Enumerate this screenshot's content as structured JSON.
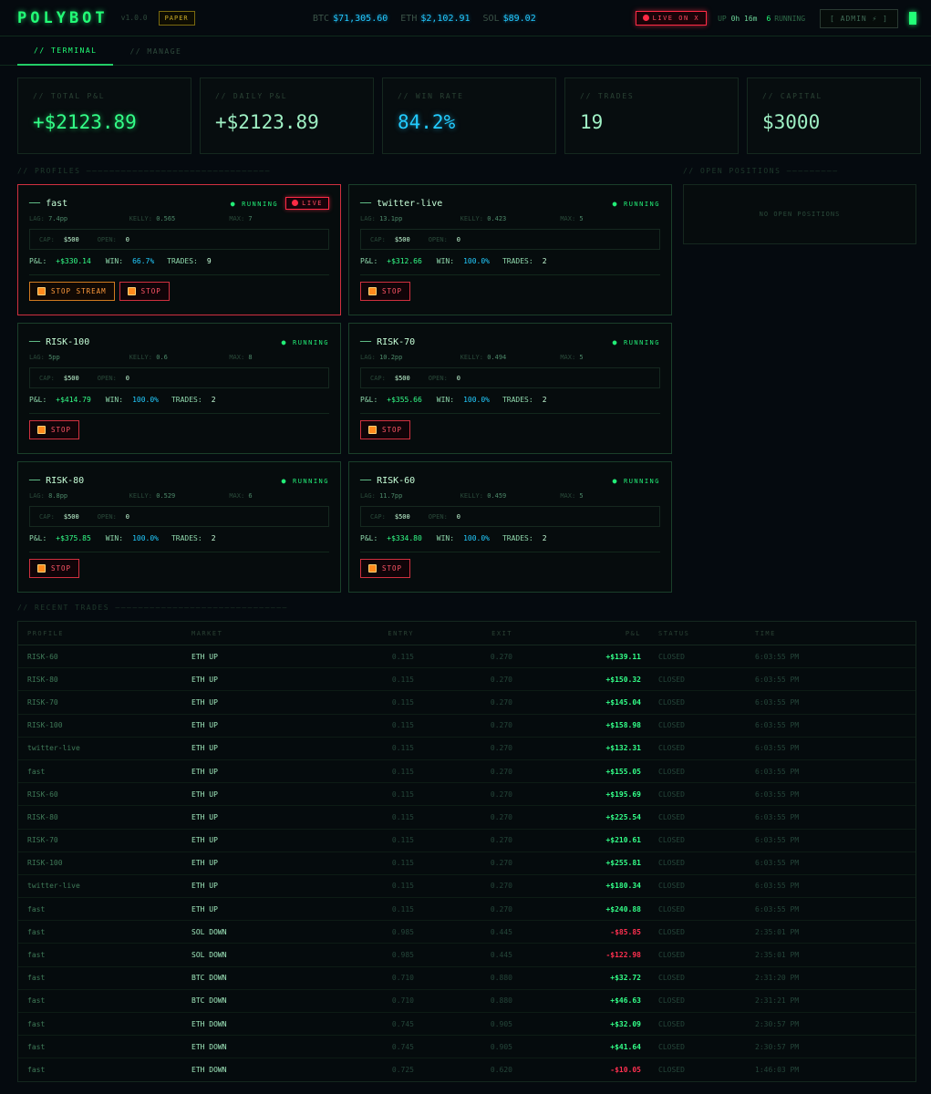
{
  "header": {
    "logo": "POLYBOT",
    "version": "v1.0.0",
    "mode_badge": "PAPER",
    "tickers": [
      {
        "symbol": "BTC",
        "price": "$71,305.60"
      },
      {
        "symbol": "ETH",
        "price": "$2,102.91"
      },
      {
        "symbol": "SOL",
        "price": "$89.02"
      }
    ],
    "live_on_x": "LIVE ON X",
    "uptime_label": "UP",
    "uptime_value": "0h 16m",
    "running_count": "6",
    "running_label": "RUNNING",
    "admin_label": "[ ADMIN ⚡ ]"
  },
  "tabs": [
    {
      "label": "// TERMINAL",
      "active": true
    },
    {
      "label": "// MANAGE",
      "active": false
    }
  ],
  "stats": [
    {
      "label": "// TOTAL P&L",
      "value": "+$2123.89",
      "style": "green"
    },
    {
      "label": "// DAILY P&L",
      "value": "+$2123.89",
      "style": "plain"
    },
    {
      "label": "// WIN RATE",
      "value": "84.2%",
      "style": "cyan"
    },
    {
      "label": "// TRADES",
      "value": "19",
      "style": "plain"
    },
    {
      "label": "// CAPITAL",
      "value": "$3000",
      "style": "plain"
    }
  ],
  "sections": {
    "profiles": "// PROFILES ————————————————————————————————",
    "open_positions": "// OPEN POSITIONS —————————",
    "recent_trades": "// RECENT TRADES ——————————————————————————————"
  },
  "open_positions_empty": "NO OPEN POSITIONS",
  "profile_labels": {
    "lag": "LAG:",
    "kelly": "KELLY:",
    "max": "MAX:",
    "cap": "CAP:",
    "open": "OPEN:",
    "pnl": "P&L:",
    "win": "WIN:",
    "trades": "TRADES:",
    "running": "RUNNING",
    "live": "LIVE",
    "stop": "STOP",
    "stop_stream": "STOP STREAM"
  },
  "profiles": [
    {
      "name": "fast",
      "live": true,
      "lag": "7.4pp",
      "kelly": "0.565",
      "max": "7",
      "cap": "$500",
      "open": "0",
      "pnl": "+$330.14",
      "win": "66.7%",
      "trades": "9"
    },
    {
      "name": "twitter-live",
      "live": false,
      "lag": "13.1pp",
      "kelly": "0.423",
      "max": "5",
      "cap": "$500",
      "open": "0",
      "pnl": "+$312.66",
      "win": "100.0%",
      "trades": "2"
    },
    {
      "name": "RISK-100",
      "live": false,
      "lag": "5pp",
      "kelly": "0.6",
      "max": "8",
      "cap": "$500",
      "open": "0",
      "pnl": "+$414.79",
      "win": "100.0%",
      "trades": "2"
    },
    {
      "name": "RISK-70",
      "live": false,
      "lag": "10.2pp",
      "kelly": "0.494",
      "max": "5",
      "cap": "$500",
      "open": "0",
      "pnl": "+$355.66",
      "win": "100.0%",
      "trades": "2"
    },
    {
      "name": "RISK-80",
      "live": false,
      "lag": "8.8pp",
      "kelly": "0.529",
      "max": "6",
      "cap": "$500",
      "open": "0",
      "pnl": "+$375.85",
      "win": "100.0%",
      "trades": "2"
    },
    {
      "name": "RISK-60",
      "live": false,
      "lag": "11.7pp",
      "kelly": "0.459",
      "max": "5",
      "cap": "$500",
      "open": "0",
      "pnl": "+$334.80",
      "win": "100.0%",
      "trades": "2"
    }
  ],
  "trades_columns": [
    "PROFILE",
    "MARKET",
    "ENTRY",
    "EXIT",
    "P&L",
    "STATUS",
    "TIME"
  ],
  "trades": [
    {
      "profile": "RISK-60",
      "market": "ETH UP",
      "entry": "0.115",
      "exit": "0.270",
      "pnl": "+$139.11",
      "status": "CLOSED",
      "time": "6:03:55 PM"
    },
    {
      "profile": "RISK-80",
      "market": "ETH UP",
      "entry": "0.115",
      "exit": "0.270",
      "pnl": "+$150.32",
      "status": "CLOSED",
      "time": "6:03:55 PM"
    },
    {
      "profile": "RISK-70",
      "market": "ETH UP",
      "entry": "0.115",
      "exit": "0.270",
      "pnl": "+$145.04",
      "status": "CLOSED",
      "time": "6:03:55 PM"
    },
    {
      "profile": "RISK-100",
      "market": "ETH UP",
      "entry": "0.115",
      "exit": "0.270",
      "pnl": "+$158.98",
      "status": "CLOSED",
      "time": "6:03:55 PM"
    },
    {
      "profile": "twitter-live",
      "market": "ETH UP",
      "entry": "0.115",
      "exit": "0.270",
      "pnl": "+$132.31",
      "status": "CLOSED",
      "time": "6:03:55 PM"
    },
    {
      "profile": "fast",
      "market": "ETH UP",
      "entry": "0.115",
      "exit": "0.270",
      "pnl": "+$155.05",
      "status": "CLOSED",
      "time": "6:03:55 PM"
    },
    {
      "profile": "RISK-60",
      "market": "ETH UP",
      "entry": "0.115",
      "exit": "0.270",
      "pnl": "+$195.69",
      "status": "CLOSED",
      "time": "6:03:55 PM"
    },
    {
      "profile": "RISK-80",
      "market": "ETH UP",
      "entry": "0.115",
      "exit": "0.270",
      "pnl": "+$225.54",
      "status": "CLOSED",
      "time": "6:03:55 PM"
    },
    {
      "profile": "RISK-70",
      "market": "ETH UP",
      "entry": "0.115",
      "exit": "0.270",
      "pnl": "+$210.61",
      "status": "CLOSED",
      "time": "6:03:55 PM"
    },
    {
      "profile": "RISK-100",
      "market": "ETH UP",
      "entry": "0.115",
      "exit": "0.270",
      "pnl": "+$255.81",
      "status": "CLOSED",
      "time": "6:03:55 PM"
    },
    {
      "profile": "twitter-live",
      "market": "ETH UP",
      "entry": "0.115",
      "exit": "0.270",
      "pnl": "+$180.34",
      "status": "CLOSED",
      "time": "6:03:55 PM"
    },
    {
      "profile": "fast",
      "market": "ETH UP",
      "entry": "0.115",
      "exit": "0.270",
      "pnl": "+$240.88",
      "status": "CLOSED",
      "time": "6:03:55 PM"
    },
    {
      "profile": "fast",
      "market": "SOL DOWN",
      "entry": "0.985",
      "exit": "0.445",
      "pnl": "-$85.85",
      "status": "CLOSED",
      "time": "2:35:01 PM"
    },
    {
      "profile": "fast",
      "market": "SOL DOWN",
      "entry": "0.985",
      "exit": "0.445",
      "pnl": "-$122.98",
      "status": "CLOSED",
      "time": "2:35:01 PM"
    },
    {
      "profile": "fast",
      "market": "BTC DOWN",
      "entry": "0.710",
      "exit": "0.880",
      "pnl": "+$32.72",
      "status": "CLOSED",
      "time": "2:31:20 PM"
    },
    {
      "profile": "fast",
      "market": "BTC DOWN",
      "entry": "0.710",
      "exit": "0.880",
      "pnl": "+$46.63",
      "status": "CLOSED",
      "time": "2:31:21 PM"
    },
    {
      "profile": "fast",
      "market": "ETH DOWN",
      "entry": "0.745",
      "exit": "0.905",
      "pnl": "+$32.09",
      "status": "CLOSED",
      "time": "2:30:57 PM"
    },
    {
      "profile": "fast",
      "market": "ETH DOWN",
      "entry": "0.745",
      "exit": "0.905",
      "pnl": "+$41.64",
      "status": "CLOSED",
      "time": "2:30:57 PM"
    },
    {
      "profile": "fast",
      "market": "ETH DOWN",
      "entry": "0.725",
      "exit": "0.620",
      "pnl": "-$10.05",
      "status": "CLOSED",
      "time": "1:46:03 PM"
    }
  ],
  "colors": {
    "accent_green": "#22ff77",
    "accent_cyan": "#22ccff",
    "danger_red": "#ff3050",
    "warning_orange": "#ff9a3c",
    "paper_gold": "#c8a926",
    "background": "#050a0f"
  },
  "icons": {
    "live_dot": "red-dot-icon",
    "stop": "stop-square-icon",
    "running": "running-dot-icon",
    "status_indicator": "status-block-icon"
  }
}
